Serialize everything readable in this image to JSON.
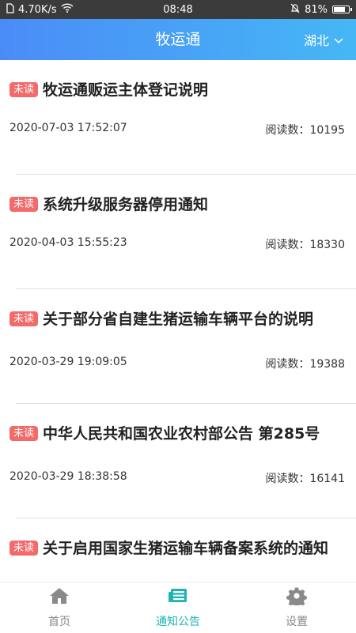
{
  "status_bar": {
    "network_speed": "4.70K/s",
    "time": "08:48",
    "battery": "81%",
    "battery_level": 0.81
  },
  "header": {
    "title": "牧运通",
    "region": "湖北"
  },
  "notices": [
    {
      "badge": "未读",
      "title": "牧运通贩运主体登记说明",
      "date": "2020-07-03 17:52:07",
      "reads": "阅读数：10195"
    },
    {
      "badge": "未读",
      "title": "系统升级服务器停用通知",
      "date": "2020-04-03 15:55:23",
      "reads": "阅读数：18330"
    },
    {
      "badge": "未读",
      "title": "关于部分省自建生猪运输车辆平台的说明",
      "date": "2020-03-29 19:09:05",
      "reads": "阅读数：19388"
    },
    {
      "badge": "未读",
      "title": "中华人民共和国农业农村部公告 第285号",
      "date": "2020-03-29 18:38:58",
      "reads": "阅读数：16141"
    },
    {
      "badge": "未读",
      "title": "关于启用国家生猪运输车辆备案系统的通知",
      "date": "",
      "reads": ""
    }
  ],
  "tabs": [
    {
      "label": "首页",
      "icon": "home-icon"
    },
    {
      "label": "通知公告",
      "icon": "news-icon",
      "active": true
    },
    {
      "label": "设置",
      "icon": "gear-icon"
    }
  ],
  "colors": {
    "header_start": "#4a8cf7",
    "header_end": "#46b7f5",
    "badge": "#f26a6a",
    "tab_active": "#1db3b3",
    "tab_inactive": "#888888"
  }
}
